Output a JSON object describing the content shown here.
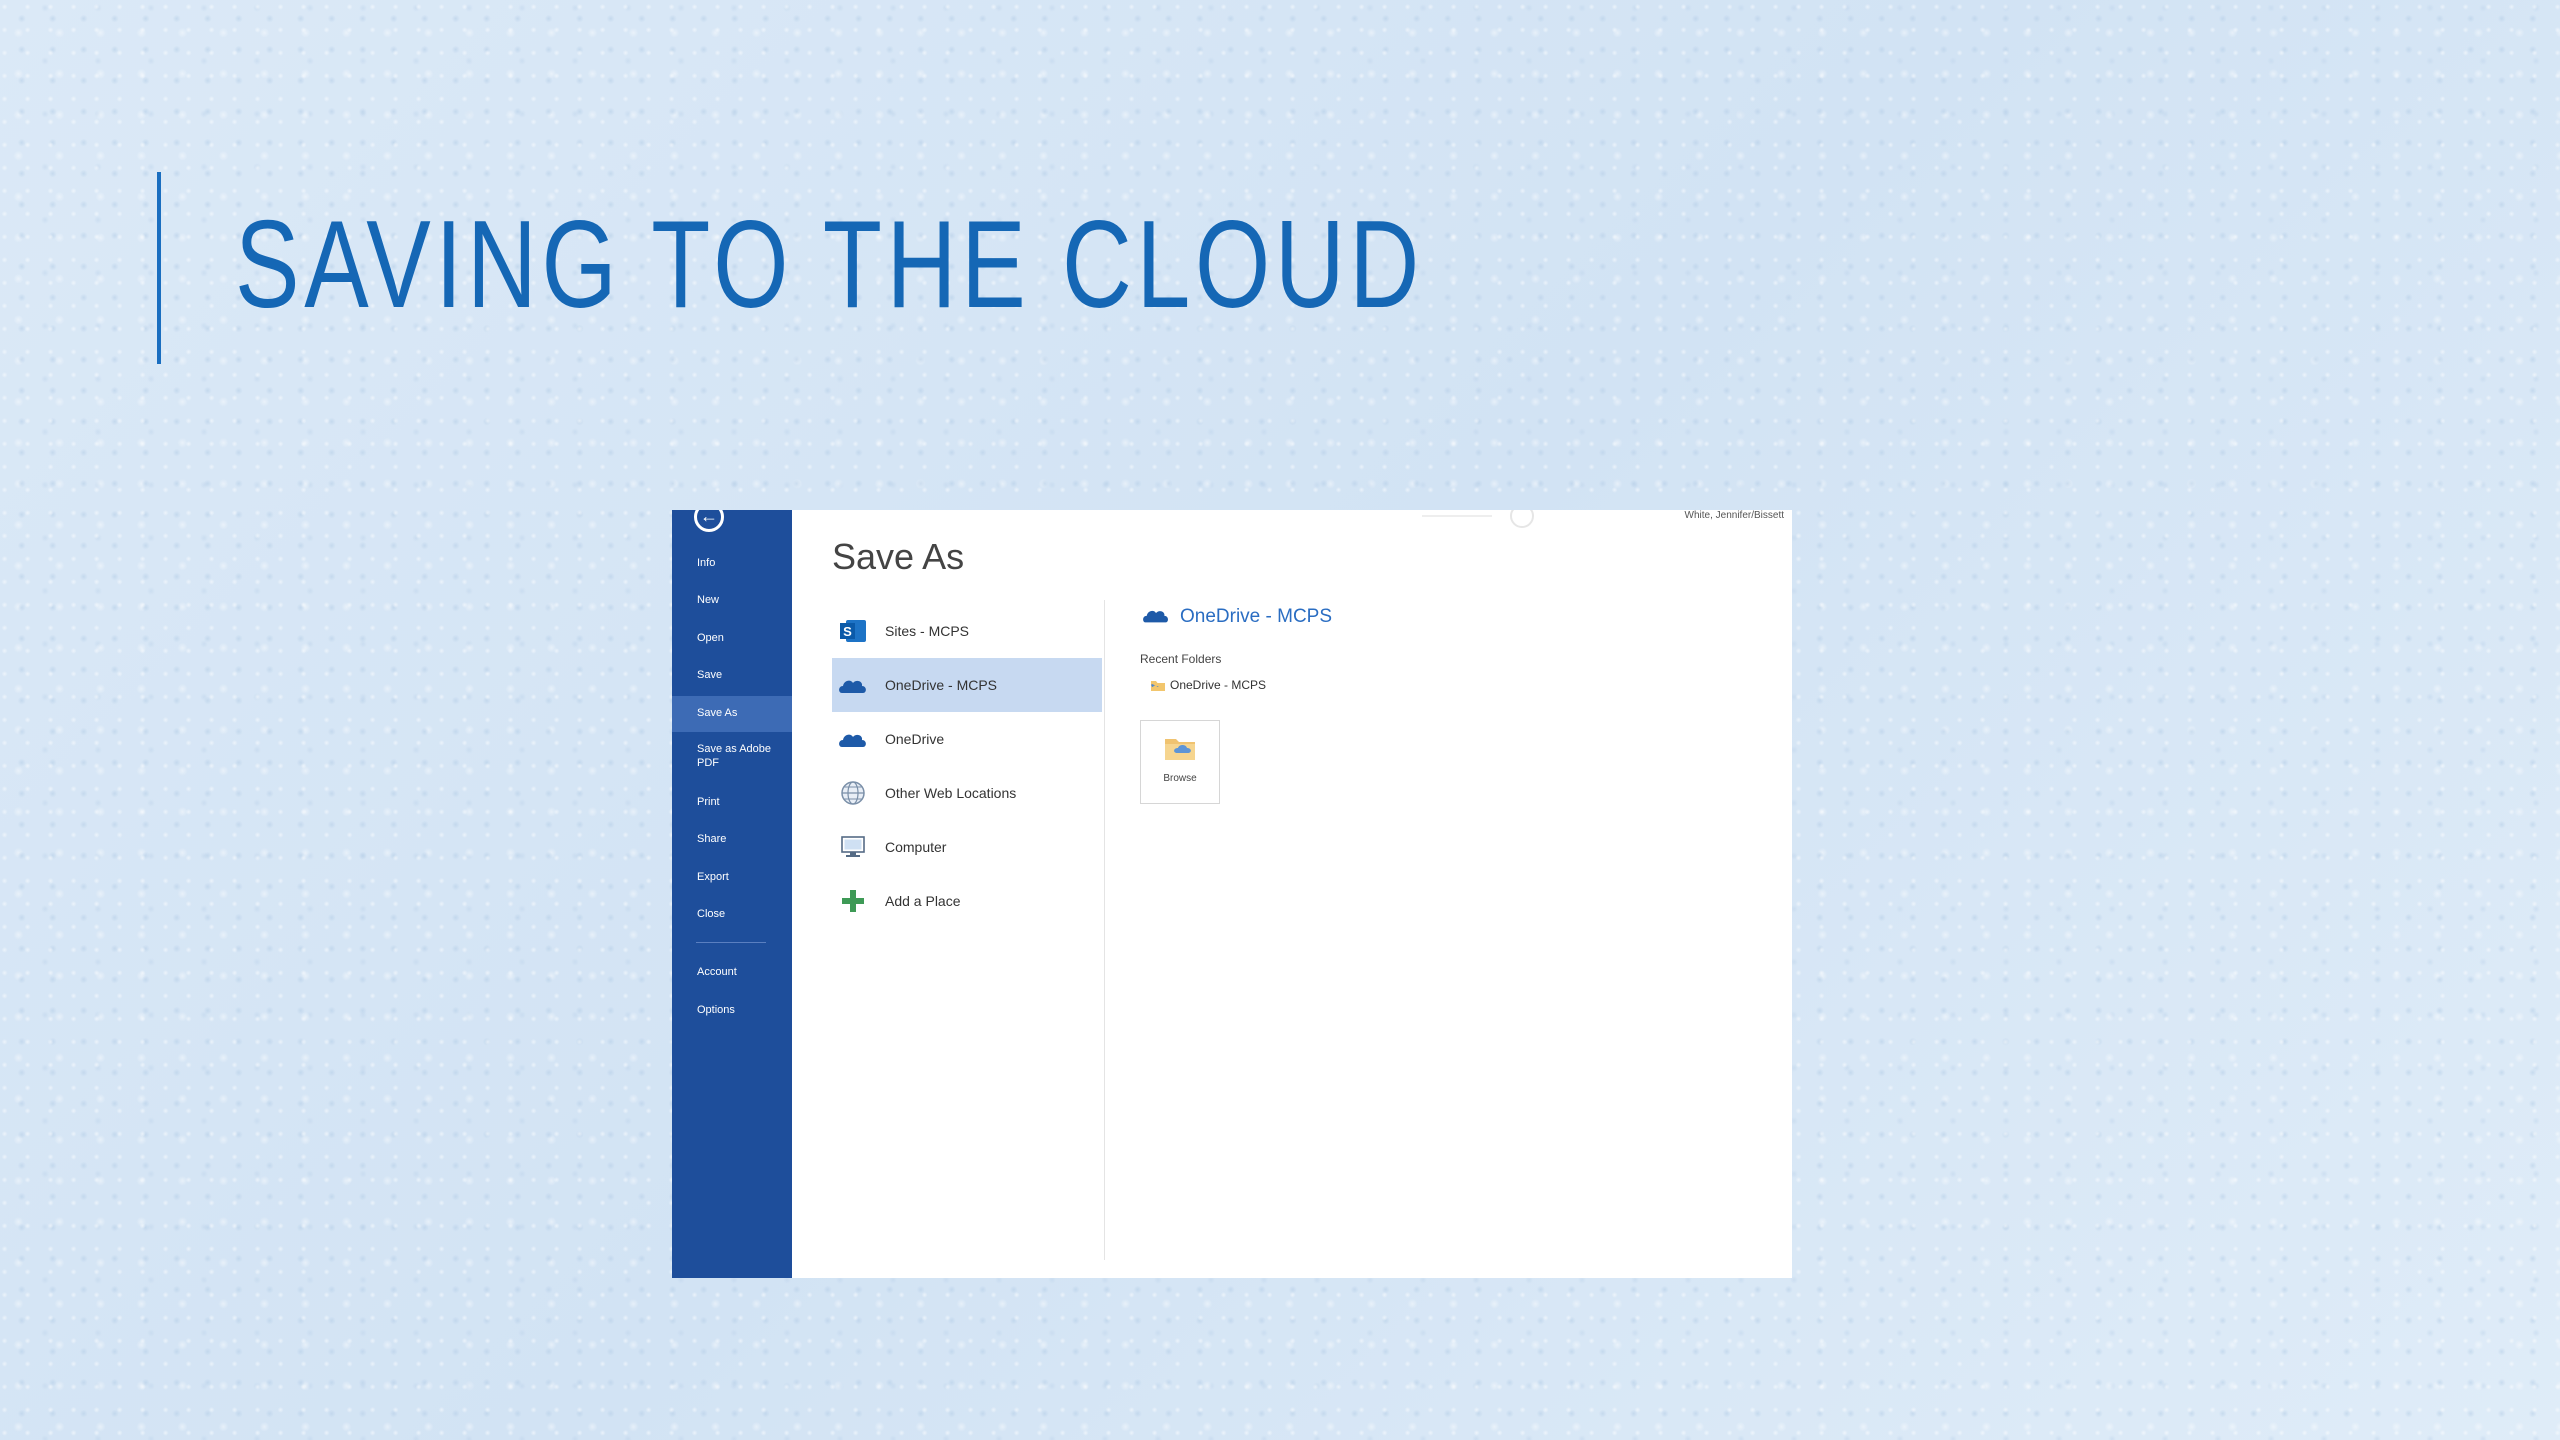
{
  "slide": {
    "title": "SAVING TO THE CLOUD"
  },
  "backstage": {
    "back_glyph": "←",
    "items": [
      {
        "label": "Info"
      },
      {
        "label": "New"
      },
      {
        "label": "Open"
      },
      {
        "label": "Save"
      },
      {
        "label": "Save As",
        "active": true
      },
      {
        "label": "Save as Adobe PDF"
      },
      {
        "label": "Print"
      },
      {
        "label": "Share"
      },
      {
        "label": "Export"
      },
      {
        "label": "Close"
      },
      {
        "label": "Account"
      },
      {
        "label": "Options"
      }
    ]
  },
  "main": {
    "title": "Save As",
    "places": [
      {
        "label": "Sites - MCPS",
        "icon": "sharepoint-icon"
      },
      {
        "label": "OneDrive - MCPS",
        "icon": "onedrive-cloud-icon",
        "selected": true
      },
      {
        "label": "OneDrive",
        "icon": "onedrive-cloud-icon"
      },
      {
        "label": "Other Web Locations",
        "icon": "globe-icon"
      },
      {
        "label": "Computer",
        "icon": "computer-icon"
      },
      {
        "label": "Add a Place",
        "icon": "plus-icon"
      }
    ],
    "right_pane": {
      "title": "OneDrive - MCPS",
      "recent_label": "Recent Folders",
      "recent_items": [
        {
          "label": "OneDrive - MCPS"
        }
      ],
      "browse_label": "Browse"
    },
    "account_text": "White, Jennifer/Bissett"
  },
  "colors": {
    "title_blue": "#1567b5",
    "backstage_blue": "#1e4e9b",
    "selected_place": "#c7d9f1",
    "onedrive_blue": "#2a6dc2"
  }
}
